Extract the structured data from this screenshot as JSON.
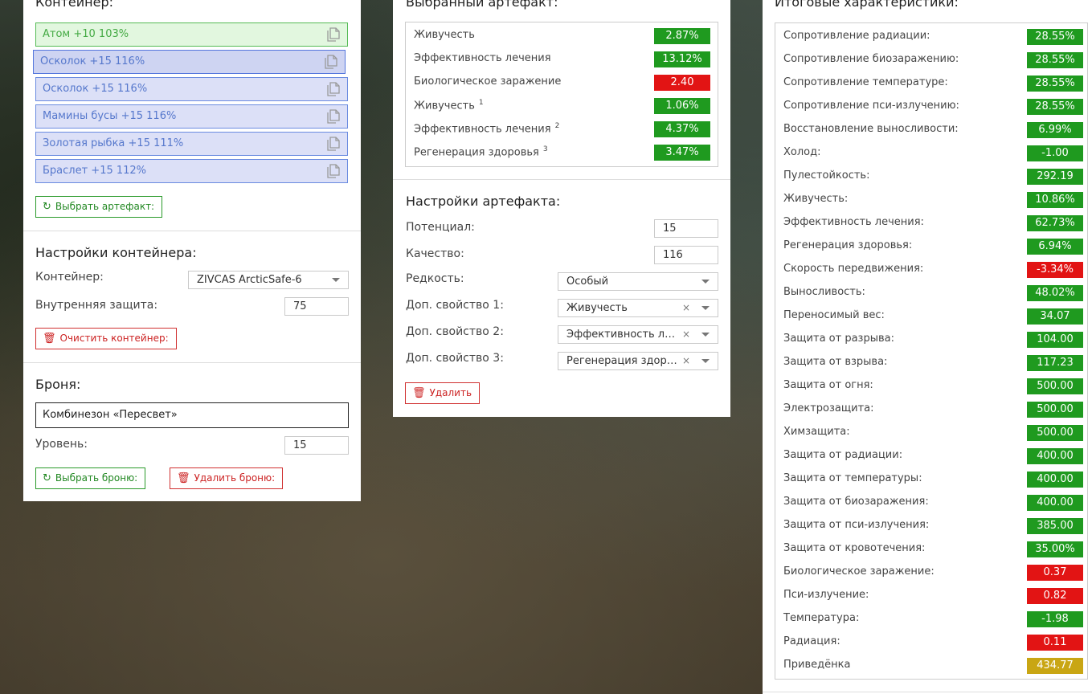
{
  "colors": {
    "green": "#1f9a1f",
    "red": "#e21414",
    "gold": "#c9a614",
    "accent_blue": "#5577cc"
  },
  "left": {
    "title": "Контейнер:",
    "items": [
      {
        "label": "Атом +10 103%"
      },
      {
        "label": "Осколок +15 116%"
      },
      {
        "label": "Осколок +15 116%"
      },
      {
        "label": "Мамины бусы +15 116%"
      },
      {
        "label": "Золотая рыбка +15 111%"
      },
      {
        "label": "Браслет +15 112%"
      }
    ],
    "choose_artifact_btn": "Выбрать артефакт:",
    "container_settings_title": "Настройки контейнера:",
    "container_label": "Контейнер:",
    "container_value": "ZIVCAS ArcticSafe-6",
    "inner_protection_label": "Внутренняя защита:",
    "inner_protection_value": "75",
    "clear_container_btn": "Очистить контейнер:",
    "armor_title": "Броня:",
    "armor_value": "Комбинезон «Пересвет»",
    "level_label": "Уровень:",
    "level_value": "15",
    "choose_armor_btn": "Выбрать броню:",
    "remove_armor_btn": "Удалить броню:"
  },
  "middle": {
    "title": "Выбранный артефакт:",
    "stats": [
      {
        "name": "Живучесть",
        "sup": "",
        "value": "2.87%",
        "color": "g"
      },
      {
        "name": "Эффективность лечения",
        "sup": "",
        "value": "13.12%",
        "color": "g"
      },
      {
        "name": "Биологическое заражение",
        "sup": "",
        "value": "2.40",
        "color": "r"
      },
      {
        "name": "Живучесть",
        "sup": "1",
        "value": "1.06%",
        "color": "g"
      },
      {
        "name": "Эффективность лечения",
        "sup": "2",
        "value": "4.37%",
        "color": "g"
      },
      {
        "name": "Регенерация здоровья",
        "sup": "3",
        "value": "3.47%",
        "color": "g"
      }
    ],
    "settings_title": "Настройки артефакта:",
    "potential_label": "Потенциал:",
    "potential_value": "15",
    "quality_label": "Качество:",
    "quality_value": "116",
    "rarity_label": "Редкость:",
    "rarity_value": "Особый",
    "prop1_label": "Доп. свойство 1:",
    "prop1_value": "Живучесть",
    "prop2_label": "Доп. свойство 2:",
    "prop2_value": "Эффективность лечения",
    "prop3_label": "Доп. свойство 3:",
    "prop3_value": "Регенерация здоровья",
    "delete_btn": "Удалить"
  },
  "right": {
    "title": "Итоговые характеристики:",
    "stats": [
      {
        "name": "Сопротивление радиации:",
        "value": "28.55%",
        "color": "g"
      },
      {
        "name": "Сопротивление биозаражению:",
        "value": "28.55%",
        "color": "g"
      },
      {
        "name": "Сопротивление температуре:",
        "value": "28.55%",
        "color": "g"
      },
      {
        "name": "Сопротивление пси-излучению:",
        "value": "28.55%",
        "color": "g"
      },
      {
        "name": "Восстановление выносливости:",
        "value": "6.99%",
        "color": "g"
      },
      {
        "name": "Холод:",
        "value": "-1.00",
        "color": "g"
      },
      {
        "name": "Пулестойкость:",
        "value": "292.19",
        "color": "g"
      },
      {
        "name": "Живучесть:",
        "value": "10.86%",
        "color": "g"
      },
      {
        "name": "Эффективность лечения:",
        "value": "62.73%",
        "color": "g"
      },
      {
        "name": "Регенерация здоровья:",
        "value": "6.94%",
        "color": "g"
      },
      {
        "name": "Скорость передвижения:",
        "value": "-3.34%",
        "color": "r"
      },
      {
        "name": "Выносливость:",
        "value": "48.02%",
        "color": "g"
      },
      {
        "name": "Переносимый вес:",
        "value": "34.07",
        "color": "g"
      },
      {
        "name": "Защита от разрыва:",
        "value": "104.00",
        "color": "g"
      },
      {
        "name": "Защита от взрыва:",
        "value": "117.23",
        "color": "g"
      },
      {
        "name": "Защита от огня:",
        "value": "500.00",
        "color": "g"
      },
      {
        "name": "Электрозащита:",
        "value": "500.00",
        "color": "g"
      },
      {
        "name": "Химзащита:",
        "value": "500.00",
        "color": "g"
      },
      {
        "name": "Защита от радиации:",
        "value": "400.00",
        "color": "g"
      },
      {
        "name": "Защита от температуры:",
        "value": "400.00",
        "color": "g"
      },
      {
        "name": "Защита от биозаражения:",
        "value": "400.00",
        "color": "g"
      },
      {
        "name": "Защита от пси-излучения:",
        "value": "385.00",
        "color": "g"
      },
      {
        "name": "Защита от кровотечения:",
        "value": "35.00%",
        "color": "g"
      },
      {
        "name": "Биологическое заражение:",
        "value": "0.37",
        "color": "r"
      },
      {
        "name": "Пси-излучение:",
        "value": "0.82",
        "color": "r"
      },
      {
        "name": "Температура:",
        "value": "-1.98",
        "color": "g"
      },
      {
        "name": "Радиация:",
        "value": "0.11",
        "color": "r"
      },
      {
        "name": "Приведёнка",
        "value": "434.77",
        "color": "y"
      }
    ]
  },
  "icons": {
    "copy": "copy-icon",
    "refresh": "refresh-icon",
    "trash": "trash-icon",
    "caret": "chevron-down-icon",
    "clear": "clear-icon"
  },
  "clear_symbol": "×"
}
